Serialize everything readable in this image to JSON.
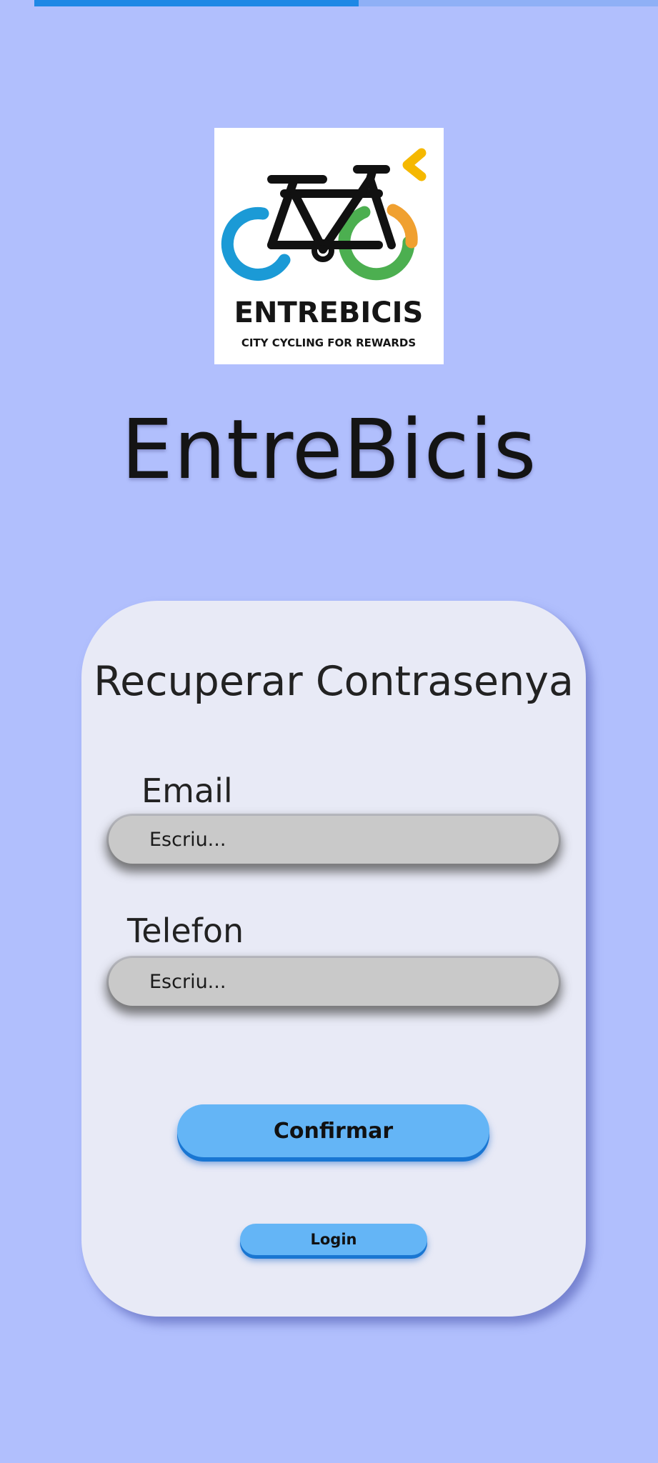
{
  "progress": {
    "value": 0.52
  },
  "colors": {
    "background": "#b1bffd",
    "card": "#e8eaf6",
    "accent": "#1e88e5",
    "button": "#64b5f6",
    "input": "#c9c9c9"
  },
  "logo": {
    "brand": "ENTREBICIS",
    "tagline": "CITY CYCLING FOR REWARDS",
    "icon": "bicycle-logo-icon"
  },
  "app": {
    "title": "EntreBicis"
  },
  "form": {
    "title": "Recuperar Contrasenya",
    "email_label": "Email",
    "email_placeholder": "Escriu...",
    "phone_label": "Telefon",
    "phone_placeholder": "Escriu...",
    "confirm_label": "Confirmar",
    "login_label": "Login"
  }
}
